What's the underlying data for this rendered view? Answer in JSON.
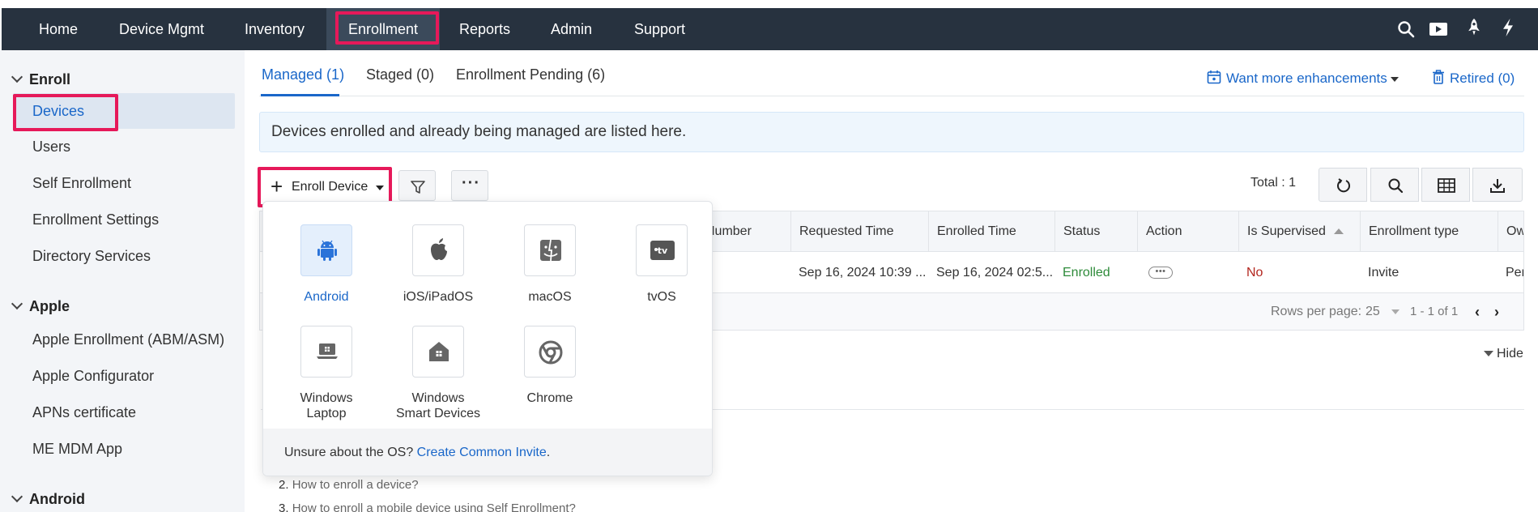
{
  "nav": {
    "items": [
      "Home",
      "Device Mgmt",
      "Inventory",
      "Enrollment",
      "Reports",
      "Admin",
      "Support"
    ],
    "active": "Enrollment"
  },
  "sidebar": {
    "sections": [
      {
        "title": "Enroll",
        "items": [
          "Devices",
          "Users",
          "Self Enrollment",
          "Enrollment Settings",
          "Directory Services"
        ]
      },
      {
        "title": "Apple",
        "items": [
          "Apple Enrollment (ABM/ASM)",
          "Apple Configurator",
          "APNs certificate",
          "ME MDM App"
        ]
      },
      {
        "title": "Android",
        "items": []
      }
    ],
    "active_item": "Devices"
  },
  "tabs": [
    "Managed (1)",
    "Staged (0)",
    "Enrollment Pending (6)"
  ],
  "header_links": {
    "enhancements": "Want more enhancements",
    "retired": "Retired (0)"
  },
  "banner": "Devices enrolled and already being managed are listed here.",
  "toolbar": {
    "enroll_device": "Enroll Device",
    "total": "Total : 1"
  },
  "table": {
    "columns": [
      "Number",
      "Requested Time",
      "Enrolled Time",
      "Status",
      "Action",
      "Is Supervised",
      "Enrollment type",
      "Ow"
    ],
    "row": {
      "requested": "Sep 16, 2024 10:39 ...",
      "enrolled": "Sep 16, 2024 02:5...",
      "status": "Enrolled",
      "supervised": "No",
      "enrollment_type": "Invite",
      "owner": "Per"
    },
    "rows_per_page_label": "Rows per page:",
    "rows_per_page": "25",
    "range": "1 - 1 of 1"
  },
  "hide_label": "Hide",
  "os_menu": {
    "options": [
      {
        "label": "Android",
        "icon": "android-icon"
      },
      {
        "label": "iOS/iPadOS",
        "icon": "apple-icon"
      },
      {
        "label": "macOS",
        "icon": "finder-icon"
      },
      {
        "label": "tvOS",
        "icon": "appletv-icon"
      },
      {
        "label_line1": "Windows",
        "label_line2": "Laptop",
        "icon": "windows-laptop-icon"
      },
      {
        "label_line1": "Windows",
        "label_line2": "Smart Devices",
        "icon": "windows-smart-icon"
      },
      {
        "label": "Chrome",
        "icon": "chrome-icon"
      }
    ],
    "footer_text": "Unsure about the OS?",
    "footer_link": "Create Common Invite"
  },
  "help": {
    "item2_num": "2.",
    "item2": "How to enroll a device?",
    "item3_num": "3.",
    "item3": "How to enroll a mobile device using Self Enrollment?"
  },
  "colors": {
    "accent": "#1a67c9",
    "nav_bg": "#27323f",
    "highlight": "#e6195a",
    "enrolled": "#2e8b3a",
    "no": "#b3261e"
  }
}
